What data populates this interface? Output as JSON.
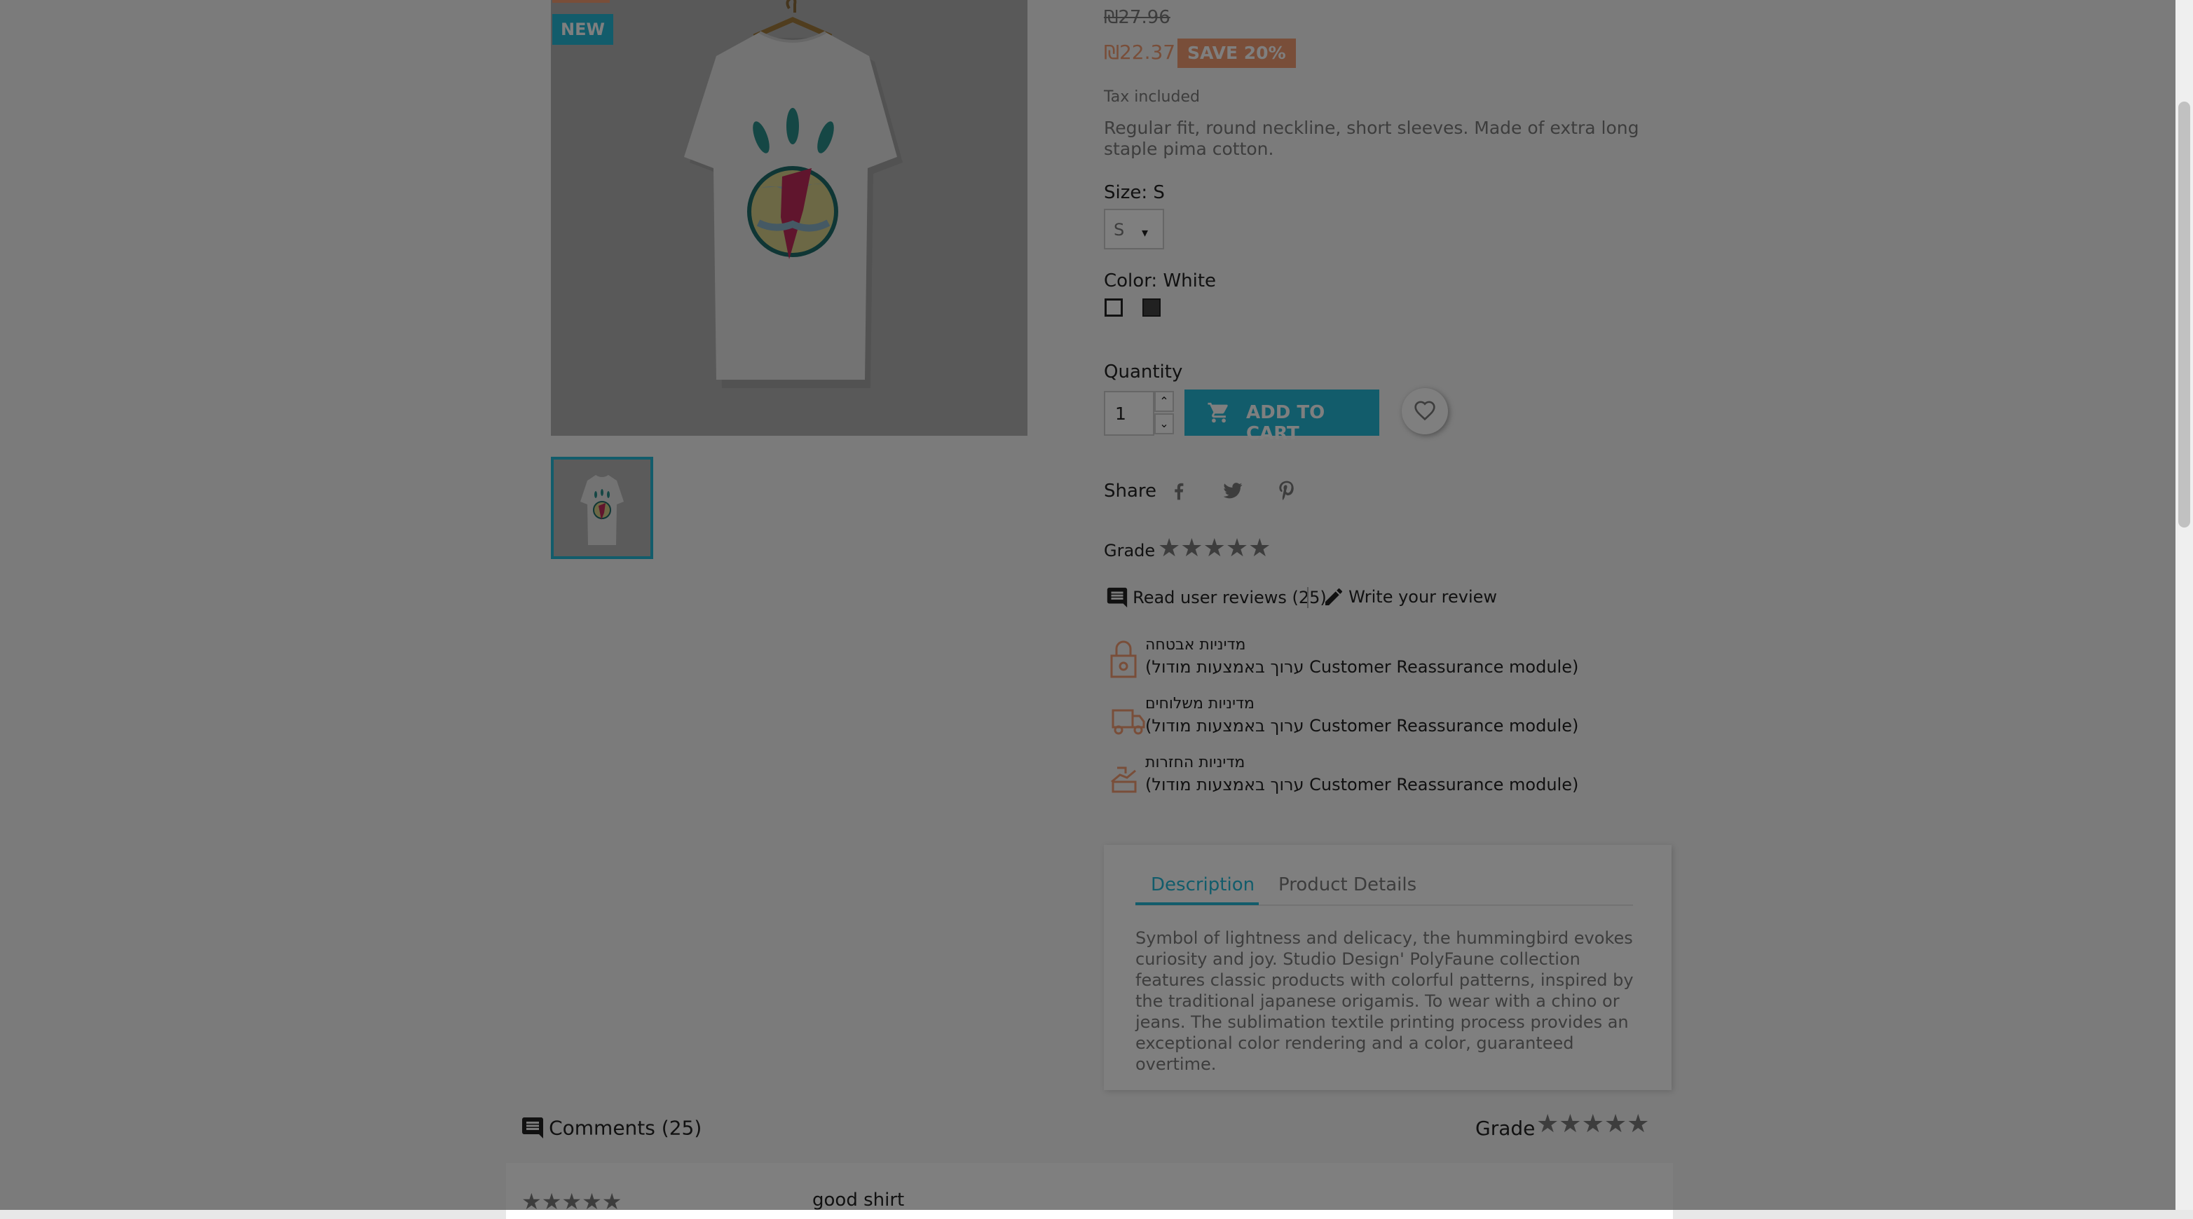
{
  "product": {
    "new_flag": "NEW",
    "old_price": "₪27.96",
    "price": "₪22.37",
    "discount_badge": "SAVE 20%",
    "tax_note": "Tax included",
    "short_description": "Regular fit, round neckline, short sleeves. Made of extra long staple pima cotton."
  },
  "variants": {
    "size_label": "Size: S",
    "size_selected": "S",
    "color_label": "Color: White",
    "colors": [
      {
        "name": "White",
        "hex": "#ffffff"
      },
      {
        "name": "Black",
        "hex": "#434343"
      }
    ]
  },
  "cart": {
    "quantity_label": "Quantity",
    "quantity_value": "1",
    "add_to_cart_label": "ADD TO CART"
  },
  "share": {
    "label": "Share",
    "networks": [
      "facebook-icon",
      "twitter-icon",
      "pinterest-icon"
    ]
  },
  "rating": {
    "grade_label": "Grade",
    "stars": 5,
    "read_reviews": "Read user reviews (25)",
    "write_review": "Write your review"
  },
  "reassurance": [
    {
      "title": "מדיניות אבטחה",
      "subtitle": "(ערוך באמצעות מודול Customer Reassurance module)",
      "icon": "security-icon"
    },
    {
      "title": "מדיניות משלוחים",
      "subtitle": "(ערוך באמצעות מודול Customer Reassurance module)",
      "icon": "delivery-icon"
    },
    {
      "title": "מדיניות החזרות",
      "subtitle": "(ערוך באמצעות מודול Customer Reassurance module)",
      "icon": "return-icon"
    }
  ],
  "tabs": {
    "items": [
      "Description",
      "Product Details"
    ],
    "active": "Description",
    "description": "Symbol of lightness and delicacy, the hummingbird evokes curiosity and joy. Studio Design' PolyFaune collection features classic products with colorful patterns, inspired by the traditional japanese origamis. To wear with a chino or jeans. The sublimation textile printing process provides an exceptional color rendering and a color, guaranteed overtime."
  },
  "comments": {
    "title": "Comments (25)",
    "grade_label": "Grade",
    "first_review_title": "good shirt"
  },
  "colors": {
    "accent": "#24b9d7",
    "price": "#f39d72",
    "text": "#232323",
    "muted": "#7a7a7a",
    "overlay": "rgba(0,0,0,0.5)"
  }
}
